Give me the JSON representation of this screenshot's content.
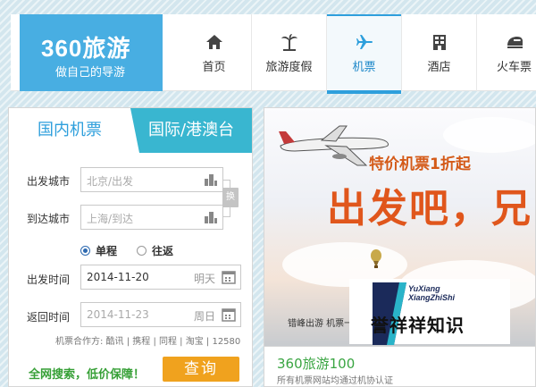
{
  "logo": {
    "brand": "360旅游",
    "tagline": "做自己的导游"
  },
  "nav": [
    {
      "label": "首页",
      "icon": "home-icon"
    },
    {
      "label": "旅游度假",
      "icon": "palm-tree-icon"
    },
    {
      "label": "机票",
      "icon": "airplane-icon",
      "active": true
    },
    {
      "label": "酒店",
      "icon": "hotel-icon"
    },
    {
      "label": "火车票",
      "icon": "train-icon"
    }
  ],
  "search": {
    "tabs": {
      "domestic": "国内机票",
      "intl": "国际/港澳台"
    },
    "from_label": "出发城市",
    "from_placeholder": "北京/出发",
    "to_label": "到达城市",
    "to_placeholder": "上海/到达",
    "swap_label": "换",
    "trip_one_way": "单程",
    "trip_round": "往返",
    "depart_label": "出发时间",
    "depart_date": "2014-11-20",
    "depart_day": "明天",
    "return_label": "返回时间",
    "return_date": "2014-11-23",
    "return_day": "周日",
    "partners": "机票合作方: 酷讯 | 携程 | 同程 | 淘宝 | 12580",
    "slogan": "全网搜索，低价保障！",
    "button": "查询"
  },
  "banner": {
    "subtitle": "特价机票1折起",
    "headline": "出发吧，兄",
    "caption": "错峰出游 机票一"
  },
  "promo": {
    "title": "360旅游100",
    "subtitle": "所有机票网站均通过机协认证"
  },
  "watermark": {
    "en_line1": "YuXiang",
    "en_line2": "XiangZhiShi",
    "cn": "誉祥祥知识"
  },
  "colors": {
    "accent": "#2e9fdc",
    "logo_bg": "#48aee2",
    "search_button": "#f0a21e",
    "banner_headline": "#e0561c",
    "slogan": "#37a037"
  }
}
